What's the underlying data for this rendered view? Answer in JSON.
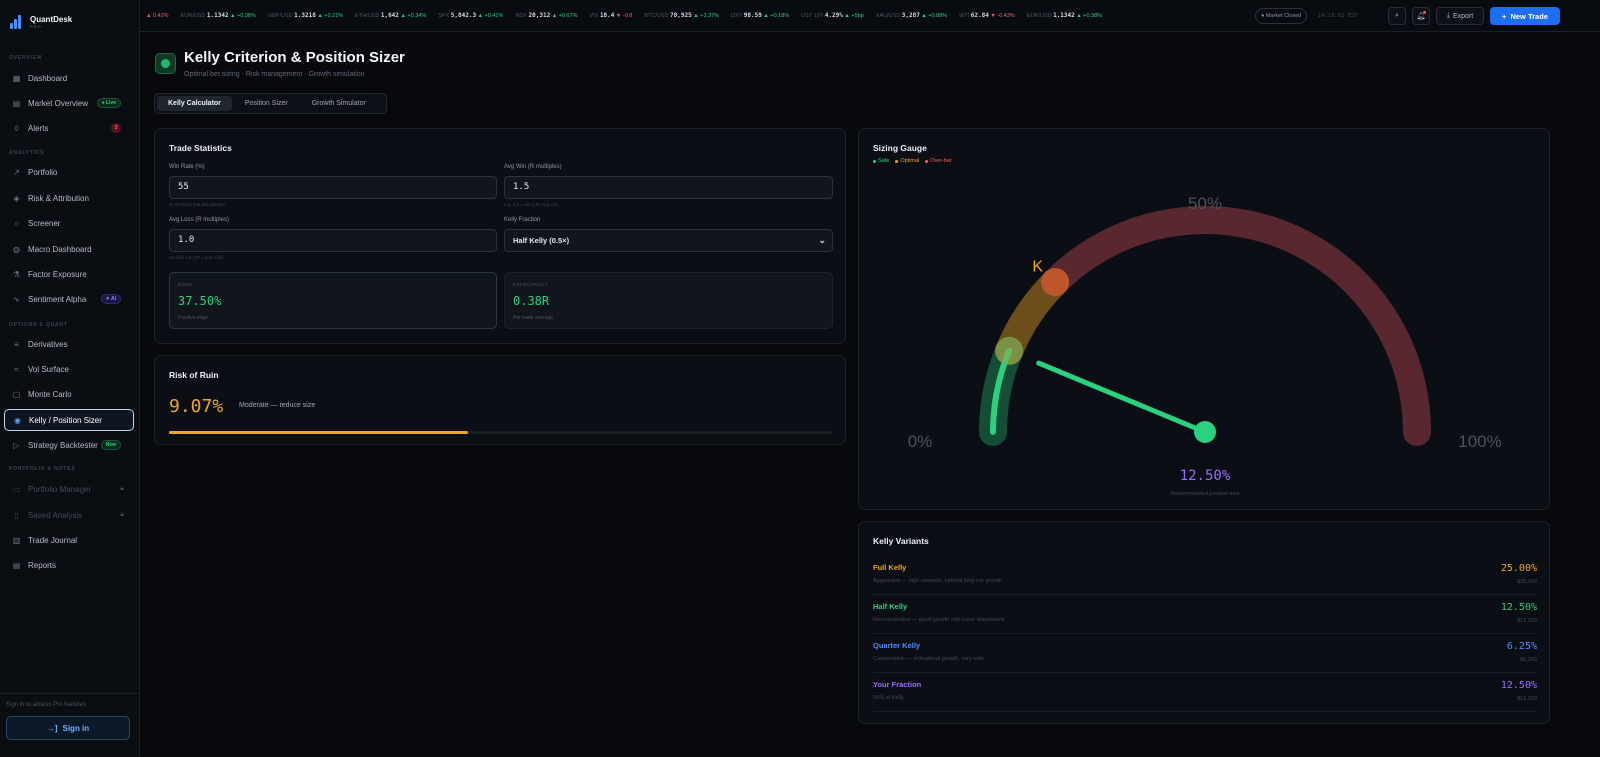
{
  "brand": {
    "name": "QuantDesk",
    "tier": "PRO"
  },
  "sidebar": {
    "sections": [
      {
        "title": "OVERVIEW",
        "items": [
          {
            "label": "Dashboard",
            "icon": "grid-icon"
          },
          {
            "label": "Market Overview",
            "icon": "chart-icon",
            "badge": "● Live"
          },
          {
            "label": "Alerts",
            "icon": "bell-icon",
            "badge": "3"
          }
        ]
      },
      {
        "title": "ANALYTICS",
        "items": [
          {
            "label": "Portfolio",
            "icon": "trend-icon"
          },
          {
            "label": "Risk & Attribution",
            "icon": "shield-icon"
          },
          {
            "label": "Screener",
            "icon": "search-icon"
          },
          {
            "label": "Macro Dashboard",
            "icon": "globe-icon"
          },
          {
            "label": "Factor Exposure",
            "icon": "flask-icon"
          },
          {
            "label": "Sentiment Alpha",
            "icon": "pulse-icon",
            "badge": "✦ AI"
          }
        ]
      },
      {
        "title": "OPTIONS & QUANT",
        "items": [
          {
            "label": "Derivatives",
            "icon": "sliders-icon"
          },
          {
            "label": "Vol Surface",
            "icon": "wave-icon"
          },
          {
            "label": "Monte Carlo",
            "icon": "dice-icon"
          },
          {
            "label": "Kelly / Position Sizer",
            "icon": "target-icon"
          },
          {
            "label": "Strategy Backtester",
            "icon": "play-icon",
            "badge": "New"
          }
        ]
      },
      {
        "title": "PORTFOLIO & NOTES",
        "items": [
          {
            "label": "Portfolio Manager",
            "icon": "folder-icon"
          },
          {
            "label": "Saved Analysis",
            "icon": "bookmark-icon"
          },
          {
            "label": "Trade Journal",
            "icon": "book-icon"
          },
          {
            "label": "Reports",
            "icon": "file-icon"
          }
        ]
      }
    ],
    "footer_text": "Sign in to access Pro features",
    "signin_label": "Sign in"
  },
  "ticker": [
    {
      "sym": "",
      "price": "",
      "chg": "▲ 0.42%",
      "dir": "dn"
    },
    {
      "sym": "EUR/USD",
      "price": "1.1342",
      "chg": "▲ +0.38%",
      "dir": "up"
    },
    {
      "sym": "GBP/USD",
      "price": "1.3218",
      "chg": "▲ +0.21%",
      "dir": "up"
    },
    {
      "sym": "ETH/USD",
      "price": "1,642",
      "chg": "▲ +0.34%",
      "dir": "up"
    },
    {
      "sym": "SPX",
      "price": "5,842.3",
      "chg": "▲ +0.41%",
      "dir": "up"
    },
    {
      "sym": "NDX",
      "price": "20,312",
      "chg": "▲ +0.67%",
      "dir": "up"
    },
    {
      "sym": "VIX",
      "price": "18.4",
      "chg": "▼ -0.8",
      "dir": "dn"
    },
    {
      "sym": "BTC/USD",
      "price": "78,925",
      "chg": "▲ +3.37%",
      "dir": "up"
    },
    {
      "sym": "DXY",
      "price": "98.59",
      "chg": "▲ +0.18%",
      "dir": "up"
    },
    {
      "sym": "UST 10Y",
      "price": "4.29%",
      "chg": "▲ +5bp",
      "dir": "up"
    },
    {
      "sym": "XAU/USD",
      "price": "3,287",
      "chg": "▲ +0.88%",
      "dir": "up"
    },
    {
      "sym": "WTI",
      "price": "62.84",
      "chg": "▼ -0.43%",
      "dir": "dn"
    },
    {
      "sym": "EUR/USD",
      "price": "1.1342",
      "chg": "▲ +0.38%",
      "dir": "up"
    }
  ],
  "topbar": {
    "market_status": "● Market Closed",
    "clock": "14:18:02 EST",
    "export_label": "Export",
    "new_trade_label": "New Trade"
  },
  "page": {
    "title": "Kelly Criterion & Position Sizer",
    "subtitle": "Optimal bet sizing · Risk management · Growth simulation",
    "tabs": [
      "Kelly Calculator",
      "Position Sizer",
      "Growth Simulator"
    ]
  },
  "trade_stats": {
    "title": "Trade Statistics",
    "win_rate": {
      "label": "Win Rate (%)",
      "value": "55",
      "hint": "% of trades that are winners"
    },
    "avg_win": {
      "label": "Avg Win (R multiples)",
      "value": "1.5",
      "hint": "e.g. 1.5 = win 1.5× avg risk"
    },
    "avg_loss": {
      "label": "Avg Loss (R multiples)",
      "value": "1.0",
      "hint": "Usually 1.0 (1R = your risk)"
    },
    "kelly_fraction": {
      "label": "Kelly Fraction",
      "value": "Half Kelly (0.5×)"
    },
    "edge": {
      "label": "EDGE",
      "value": "37.50%",
      "sub": "Positive edge"
    },
    "expectancy": {
      "label": "EXPECTANCY",
      "value": "0.38R",
      "sub": "Per trade average"
    }
  },
  "risk_of_ruin": {
    "title": "Risk of Ruin",
    "value": "9.07%",
    "note": "Moderate — reduce size",
    "fill_fraction": 0.45
  },
  "gauge": {
    "title": "Sizing Gauge",
    "legend": [
      {
        "label": "Safe",
        "color": "#2bd17e"
      },
      {
        "label": "Optimal",
        "color": "#f0a71e"
      },
      {
        "label": "Over-bet",
        "color": "#ff5a6b"
      }
    ],
    "min_label": "0%",
    "mid_label": "50%",
    "max_label": "100%",
    "kelly_marker": "K",
    "kelly_pct": 25.0,
    "value_pct": 12.5,
    "value_label": "12.50%",
    "caption": "Recommended position size"
  },
  "variants": {
    "title": "Kelly Variants",
    "items": [
      {
        "name": "Full Kelly",
        "desc": "Aggressive — high variance, optimal long-run growth",
        "pct": "25.00%",
        "amount": "$25,000",
        "color": "#f0a71e"
      },
      {
        "name": "Half Kelly",
        "desc": "Recommended — good growth with lower drawdowns",
        "pct": "12.50%",
        "amount": "$12,500",
        "color": "#2bd17e"
      },
      {
        "name": "Quarter Kelly",
        "desc": "Conservative — suboptimal growth, very safe",
        "pct": "6.25%",
        "amount": "$6,250",
        "color": "#4c8dff"
      },
      {
        "name": "Your Fraction",
        "desc": "50% of Kelly",
        "pct": "12.50%",
        "amount": "$12,500",
        "color": "#9b6dff"
      }
    ]
  }
}
